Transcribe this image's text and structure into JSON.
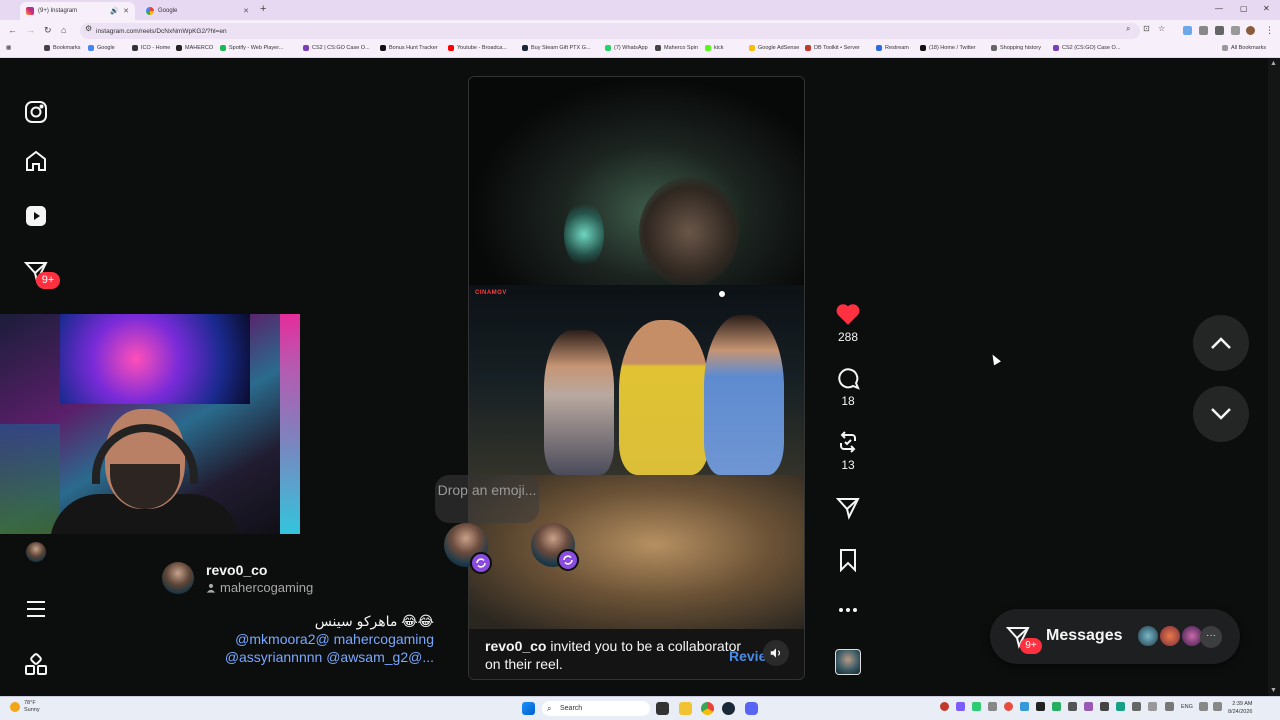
{
  "browser": {
    "tabs": [
      {
        "title": "(9+) Instagram",
        "active": true
      },
      {
        "title": "Google",
        "active": false
      }
    ],
    "url": "instagram.com/reels/DcNxNmWpKG2/?hl=en",
    "bookmarks": [
      "Bookmarks",
      "Google",
      "ICO - Home",
      "MAHERCO",
      "Spotify - Web Player...",
      "CS2 | CS:GO Case O...",
      "Bonus Hunt Tracker",
      "Youtube - Broadca...",
      "Buy Steam Gift PTX G...",
      "(7) WhatsApp",
      "Maherco Spin",
      "kick",
      "Google AdSense",
      "DB Toolkit • Server",
      "Restream",
      "(18) Home / Twitter",
      "Shopping history",
      "CS2 (CS:GO) Case O..."
    ],
    "all_bookmarks": "All Bookmarks"
  },
  "sidebar": {
    "notif_badge": "9+"
  },
  "reel": {
    "clip_logo": "CINAMOV",
    "drop_emoji": "Drop an emoji...",
    "banner_user": "revo0_co",
    "banner_text": " invited you to be a collaborator on their reel.",
    "review": "Revie",
    "author": "revo0_co",
    "author_sub": "mahercogaming",
    "caption_line1": "ماهركو سينس 😂😂",
    "caption_line2": "@mkmoora2@ mahercogaming",
    "caption_line3": "@assyriannnnn @awsam_g2@...",
    "likes": "288",
    "comments": "18",
    "reposts": "13"
  },
  "messages": {
    "label": "Messages",
    "badge": "9+"
  },
  "taskbar": {
    "weather_temp": "78°F",
    "weather_desc": "Sunny",
    "search": "Search",
    "lang": "ENG",
    "time": "2:39 AM",
    "date": "8/24/2026"
  },
  "colors": {
    "like_red": "#ff3040",
    "review_blue": "#4a8ce8",
    "page_bg": "#0c0d0d"
  }
}
